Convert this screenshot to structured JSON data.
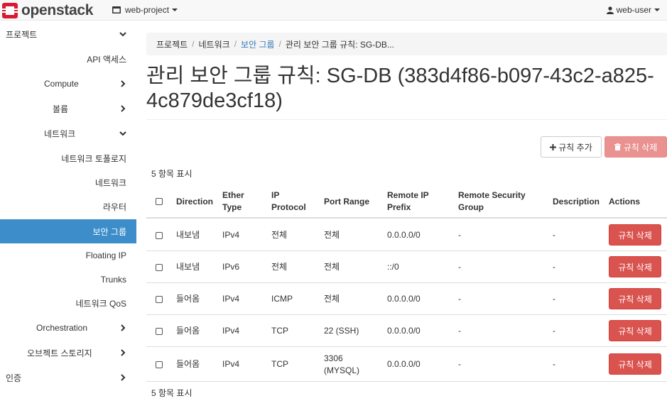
{
  "navbar": {
    "brand": "openstack",
    "project": "web-project",
    "user": "web-user"
  },
  "sidebar": {
    "items": [
      {
        "label": "프로젝트"
      },
      {
        "label": "API 액세스"
      },
      {
        "label": "Compute"
      },
      {
        "label": "볼륨"
      },
      {
        "label": "네트워크"
      },
      {
        "label": "네트워크 토폴로지"
      },
      {
        "label": "네트워크"
      },
      {
        "label": "라우터"
      },
      {
        "label": "보안 그룹"
      },
      {
        "label": "Floating IP"
      },
      {
        "label": "Trunks"
      },
      {
        "label": "네트워크 QoS"
      },
      {
        "label": "Orchestration"
      },
      {
        "label": "오브젝트 스토리지"
      },
      {
        "label": "인증"
      }
    ]
  },
  "breadcrumb": [
    "프로젝트",
    "네트워크",
    "보안 그룹",
    "관리 보안 그룹 규칙: SG-DB..."
  ],
  "page_title": "관리 보안 그룹 규칙: SG-DB (383d4f86-b097-43c2-a825-4c879de3cf18)",
  "toolbar": {
    "add_label": "규칙 추가",
    "delete_label": "규칙 삭제"
  },
  "count_label": "5 항목 표시",
  "table": {
    "columns": [
      "Direction",
      "Ether Type",
      "IP Protocol",
      "Port Range",
      "Remote IP Prefix",
      "Remote Security Group",
      "Description",
      "Actions"
    ],
    "rows": [
      {
        "direction": "내보냄",
        "ether": "IPv4",
        "protocol": "전체",
        "port": "전체",
        "prefix": "0.0.0.0/0",
        "group": "-",
        "desc": "-",
        "action": "규칙 삭제"
      },
      {
        "direction": "내보냄",
        "ether": "IPv6",
        "protocol": "전체",
        "port": "전체",
        "prefix": "::/0",
        "group": "-",
        "desc": "-",
        "action": "규칙 삭제"
      },
      {
        "direction": "들어옴",
        "ether": "IPv4",
        "protocol": "ICMP",
        "port": "전체",
        "prefix": "0.0.0.0/0",
        "group": "-",
        "desc": "-",
        "action": "규칙 삭제"
      },
      {
        "direction": "들어옴",
        "ether": "IPv4",
        "protocol": "TCP",
        "port": "22 (SSH)",
        "prefix": "0.0.0.0/0",
        "group": "-",
        "desc": "-",
        "action": "규칙 삭제"
      },
      {
        "direction": "들어옴",
        "ether": "IPv4",
        "protocol": "TCP",
        "port": "3306 (MYSQL)",
        "prefix": "0.0.0.0/0",
        "group": "-",
        "desc": "-",
        "action": "규칙 삭제"
      }
    ]
  },
  "colors": {
    "active": "#3c8dca",
    "danger": "#d9534f",
    "link": "#337ab7",
    "brand_red": "#da1a32"
  }
}
